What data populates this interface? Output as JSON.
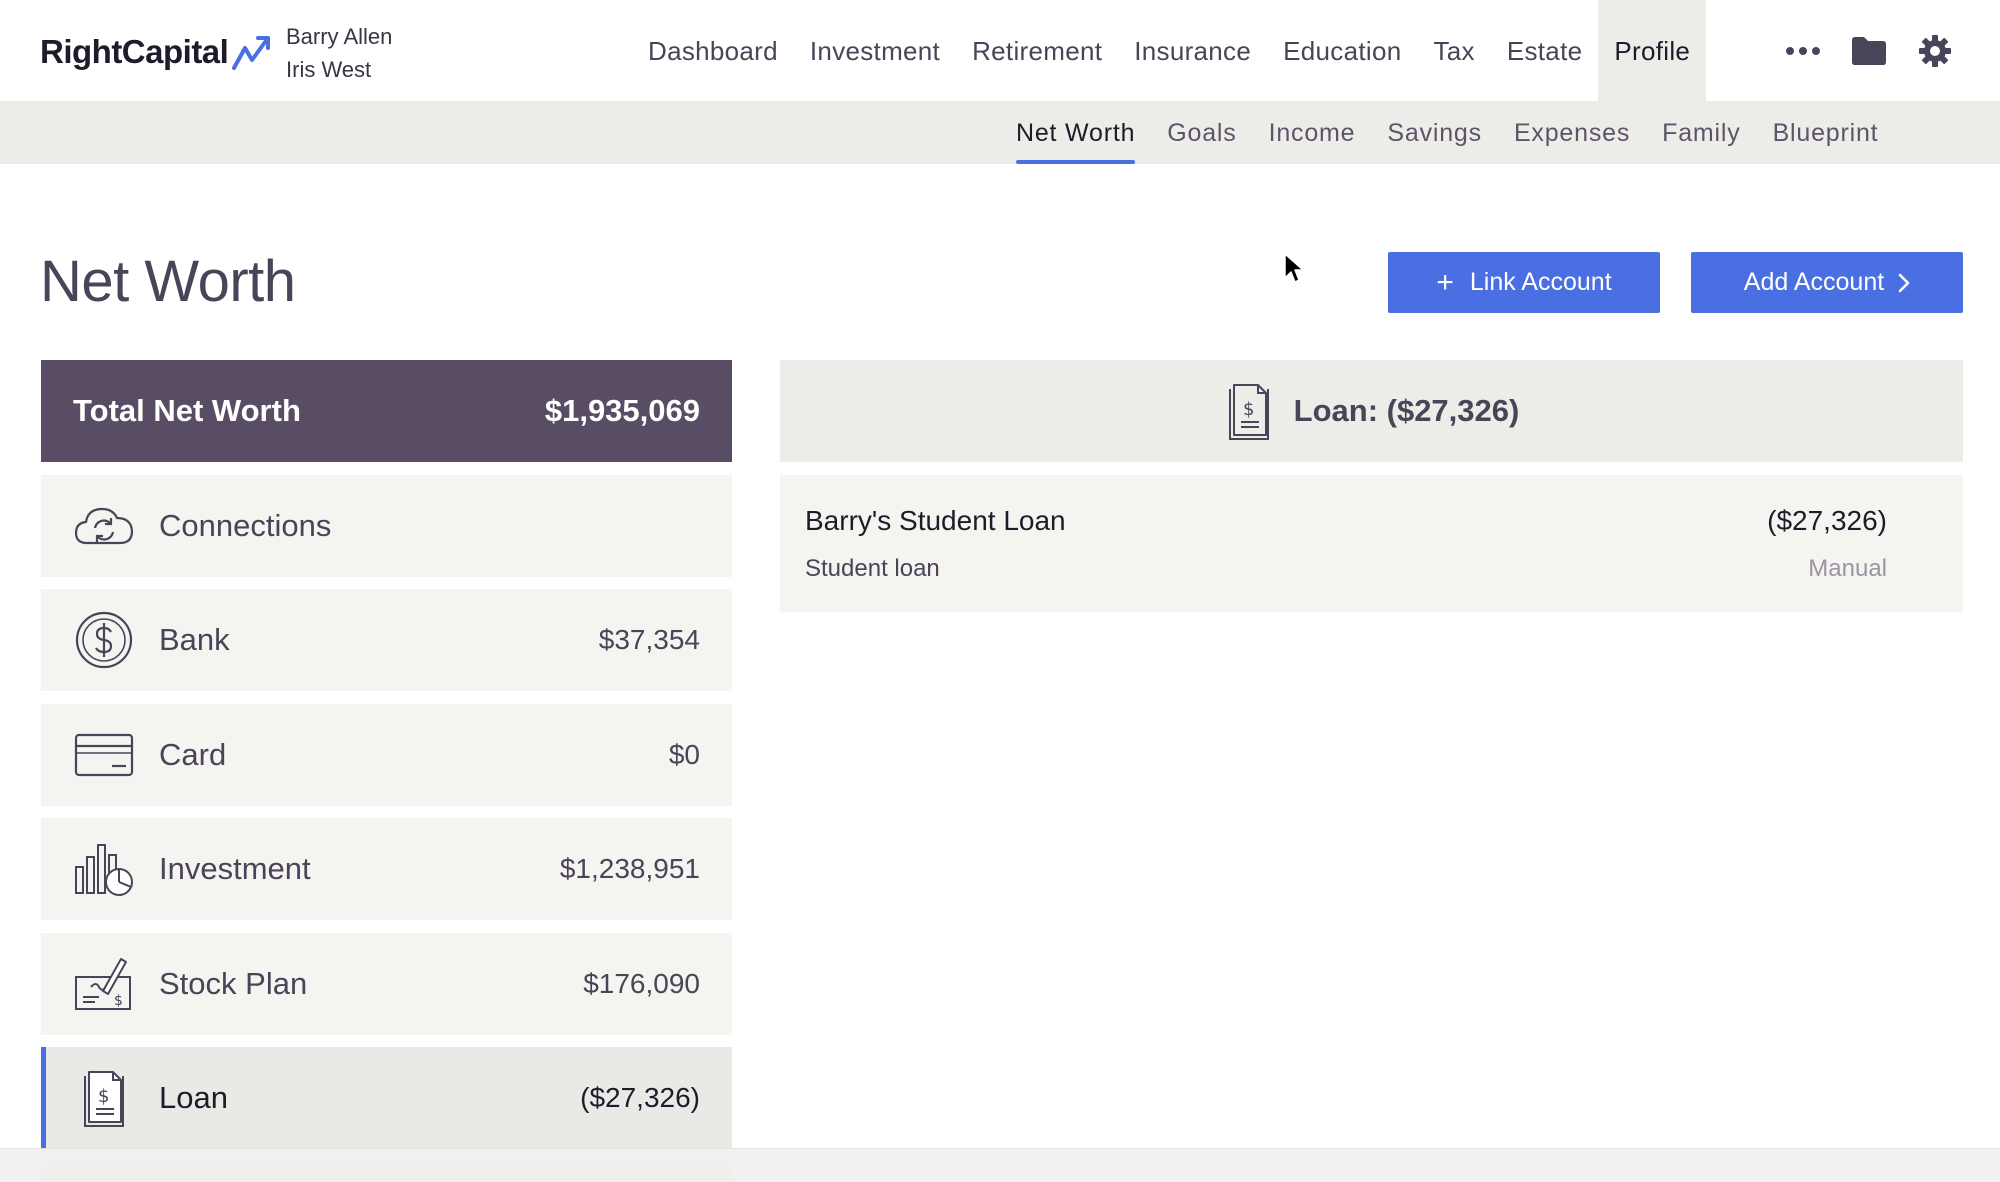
{
  "app": {
    "logo": "RightCapital",
    "clients": [
      "Barry Allen",
      "Iris West"
    ]
  },
  "main_nav": {
    "items": [
      "Dashboard",
      "Investment",
      "Retirement",
      "Insurance",
      "Education",
      "Tax",
      "Estate",
      "Profile"
    ],
    "active": "Profile",
    "icons": [
      "more-icon",
      "folder-icon",
      "gear-icon"
    ]
  },
  "sub_nav": {
    "items": [
      "Net Worth",
      "Goals",
      "Income",
      "Savings",
      "Expenses",
      "Family",
      "Blueprint"
    ],
    "active": "Net Worth"
  },
  "page": {
    "title": "Net Worth",
    "link_account_label": "Link Account",
    "add_account_label": "Add Account"
  },
  "summary": {
    "label": "Total Net Worth",
    "value": "$1,935,069"
  },
  "categories": [
    {
      "label": "Connections",
      "value": "",
      "icon": "cloud-sync-icon"
    },
    {
      "label": "Bank",
      "value": "$37,354",
      "icon": "dollar-coin-icon"
    },
    {
      "label": "Card",
      "value": "$0",
      "icon": "credit-card-icon"
    },
    {
      "label": "Investment",
      "value": "$1,238,951",
      "icon": "bar-chart-pie-icon"
    },
    {
      "label": "Stock Plan",
      "value": "$176,090",
      "icon": "check-signature-icon"
    },
    {
      "label": "Loan",
      "value": "($27,326)",
      "icon": "loan-document-icon",
      "selected": true
    }
  ],
  "detail": {
    "header": "Loan: ($27,326)",
    "accounts": [
      {
        "name": "Barry's Student Loan",
        "type": "Student loan",
        "amount": "($27,326)",
        "source": "Manual"
      }
    ]
  },
  "colors": {
    "accent": "#4a6fe3",
    "summary_bg": "#594d66",
    "row_bg": "#f6f4f1",
    "subnav_bg": "#eeece9"
  }
}
